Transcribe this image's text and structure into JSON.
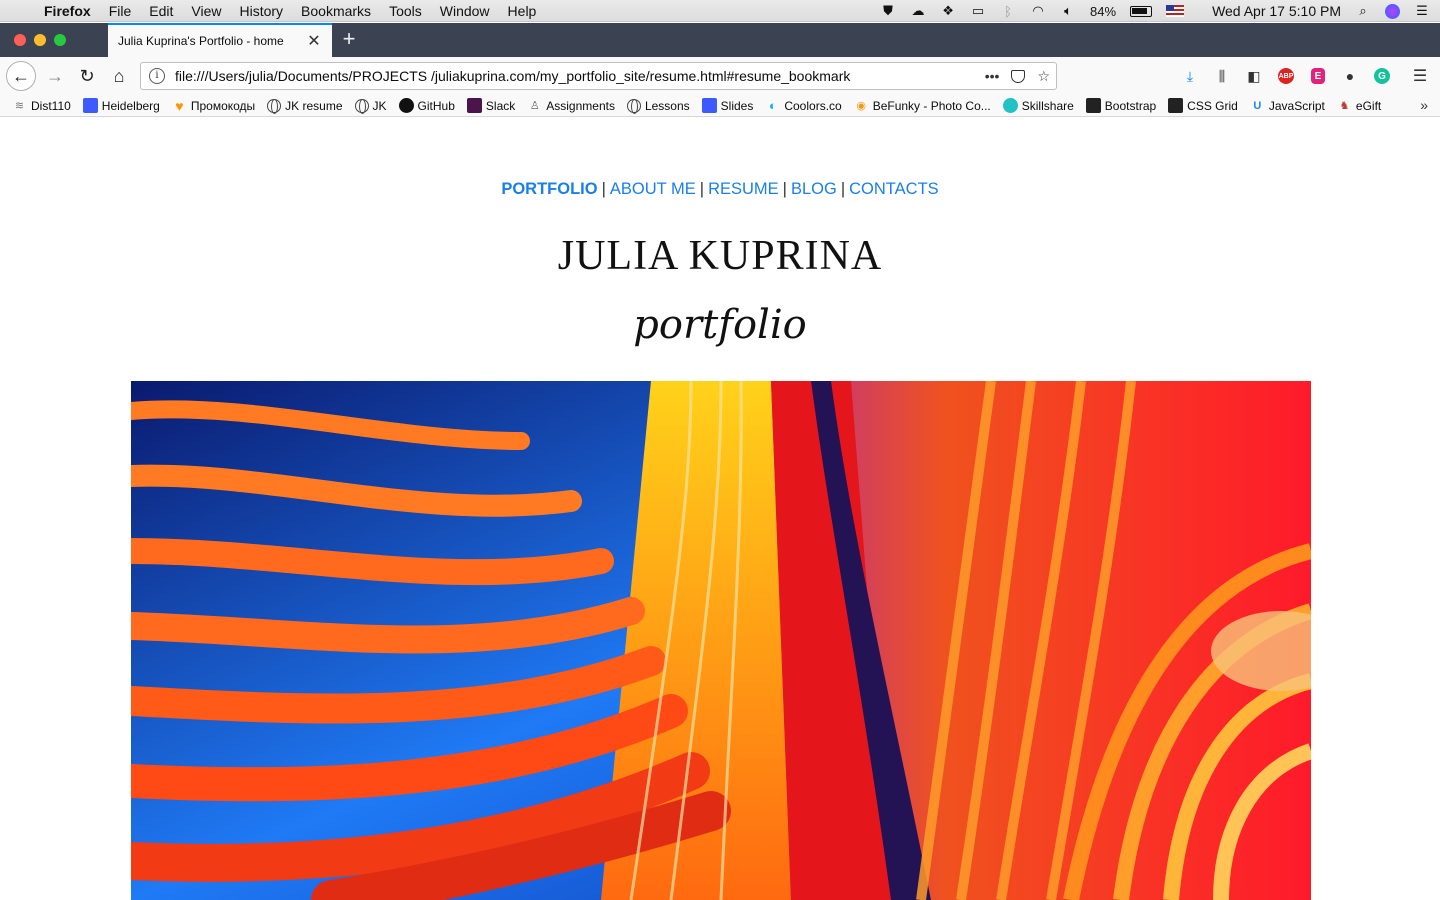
{
  "menubar": {
    "app": "Firefox",
    "items": [
      "File",
      "Edit",
      "View",
      "History",
      "Bookmarks",
      "Tools",
      "Window",
      "Help"
    ],
    "battery": "84%",
    "clock": "Wed Apr 17  5:10 PM"
  },
  "tab": {
    "title": "Julia Kuprina's Portfolio - home"
  },
  "urlbar": {
    "url": "file:///Users/julia/Documents/PROJECTS /juliakuprina.com/my_portfolio_site/resume.html#resume_bookmark"
  },
  "bookmarks": [
    {
      "label": "Dist110",
      "icon": "dist-icon"
    },
    {
      "label": "Heidelberg",
      "icon": "calendar-icon"
    },
    {
      "label": "Промокоды",
      "icon": "heart-icon"
    },
    {
      "label": "JK resume",
      "icon": "globe-icon"
    },
    {
      "label": "JK",
      "icon": "globe-icon"
    },
    {
      "label": "GitHub",
      "icon": "github-icon"
    },
    {
      "label": "Slack",
      "icon": "slack-icon"
    },
    {
      "label": "Assignments",
      "icon": "person-icon"
    },
    {
      "label": "Lessons",
      "icon": "globe-icon"
    },
    {
      "label": "Slides",
      "icon": "calendar-icon"
    },
    {
      "label": "Coolors.co",
      "icon": "coolors-icon"
    },
    {
      "label": "BeFunky - Photo Co...",
      "icon": "befunky-icon"
    },
    {
      "label": "Skillshare",
      "icon": "skillshare-icon"
    },
    {
      "label": "Bootstrap",
      "icon": "grid-icon"
    },
    {
      "label": "CSS Grid",
      "icon": "grid-icon"
    },
    {
      "label": "JavaScript",
      "icon": "udemy-icon"
    },
    {
      "label": "eGift",
      "icon": "gift-icon"
    }
  ],
  "site": {
    "nav": [
      "PORTFOLIO",
      "ABOUT ME",
      "RESUME",
      "BLOG",
      "CONTACTS"
    ],
    "active": "PORTFOLIO",
    "title": "JULIA KUPRINA",
    "subtitle": "portfolio"
  },
  "colors": {
    "link": "#1a7fe8",
    "tab_accent": "#0a84ff",
    "tabstrip": "#3b4252"
  }
}
